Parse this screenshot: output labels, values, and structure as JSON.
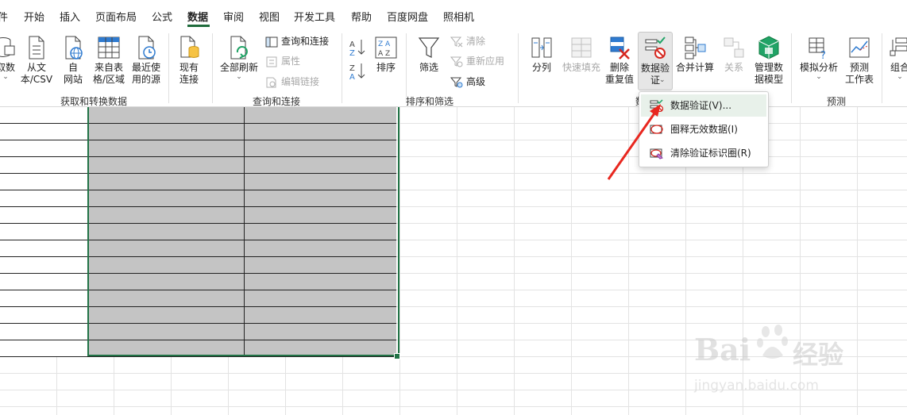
{
  "menu": {
    "items": [
      {
        "id": "file",
        "label": "件"
      },
      {
        "id": "home",
        "label": "开始"
      },
      {
        "id": "insert",
        "label": "插入"
      },
      {
        "id": "layout",
        "label": "页面布局"
      },
      {
        "id": "formula",
        "label": "公式"
      },
      {
        "id": "data",
        "label": "数据"
      },
      {
        "id": "review",
        "label": "审阅"
      },
      {
        "id": "view",
        "label": "视图"
      },
      {
        "id": "dev",
        "label": "开发工具"
      },
      {
        "id": "help",
        "label": "帮助"
      },
      {
        "id": "baidu",
        "label": "百度网盘"
      },
      {
        "id": "camera",
        "label": "照相机"
      }
    ],
    "active": "数据"
  },
  "ribbon": {
    "get_data": {
      "group_label": "获取和转换数据",
      "get_data_btn": "取数",
      "from_text_line1": "从文",
      "from_text_line2": "本/CSV",
      "from_web_line1": "自",
      "from_web_line2": "网站",
      "from_table_line1": "来自表",
      "from_table_line2": "格/区域",
      "recent_line1": "最近使",
      "recent_line2": "用的源",
      "existing_line1": "现有",
      "existing_line2": "连接"
    },
    "queries": {
      "group_label": "查询和连接",
      "refresh_all": "全部刷新",
      "queries_connections": "查询和连接",
      "properties": "属性",
      "edit_links": "编辑链接"
    },
    "sort_filter": {
      "group_label": "排序和筛选",
      "sort": "排序",
      "filter": "筛选",
      "clear": "清除",
      "reapply": "重新应用",
      "advanced": "高级"
    },
    "data_tools": {
      "group_label": "数",
      "split": "分列",
      "flash_fill": "快速填充",
      "remove_dup_line1": "删除",
      "remove_dup_line2": "重复值",
      "validation_line1": "数据验",
      "validation_line2": "证",
      "consolidate": "合并计算",
      "relations": "关系",
      "manage_model_line1": "管理数",
      "manage_model_line2": "据模型"
    },
    "forecast": {
      "group_label": "预测",
      "what_if": "模拟分析",
      "forecast_line1": "预测",
      "forecast_line2": "工作表"
    },
    "outline": {
      "group_btn": "组合"
    }
  },
  "dropdown": {
    "items": [
      {
        "label": "数据验证(V)..."
      },
      {
        "label": "圈释无效数据(I)"
      },
      {
        "label": "清除验证标识圈(R)"
      }
    ]
  },
  "colors": {
    "accent_green": "#217346",
    "annotation_red": "#e8271f",
    "selected_fill": "#c4c4c4"
  },
  "watermark": {
    "line1": "Bai",
    "line2": "经验",
    "url": "jingyan.baidu.com"
  }
}
